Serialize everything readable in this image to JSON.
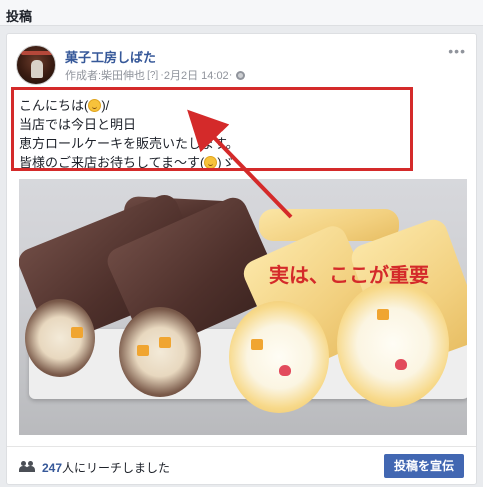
{
  "section": {
    "title": "投稿"
  },
  "post": {
    "page_name": "菓子工房しばた",
    "meta": {
      "author_prefix": "作成者: ",
      "author_name": "柴田伸也",
      "help_marker": "[?]",
      "date_separator": " · ",
      "date": "2月2日 14:02",
      "privacy_separator": " · ",
      "privacy_icon": "globe-icon"
    },
    "more_icon": "more-options-icon",
    "text_lines": [
      {
        "before": "こんにちは(",
        "after": ")/"
      },
      {
        "before": "当店では今日と明日"
      },
      {
        "before": "恵方ロールケーキを販売いたします。"
      },
      {
        "before": "皆様のご来店お待ちしてま〜す(",
        "after": ")ゞ"
      }
    ],
    "emoji_icon": "smiley-emoji-icon",
    "image_subject": "roll-cakes-photo"
  },
  "annotation": {
    "label": "実は、ここが重要",
    "color": "#d42a2a"
  },
  "footer": {
    "reach_count": "247",
    "reach_suffix": "人にリーチしました",
    "boost_button": "投稿を宣伝"
  },
  "colors": {
    "link": "#365899",
    "button": "#4267b2",
    "highlight": "#d42a2a"
  }
}
